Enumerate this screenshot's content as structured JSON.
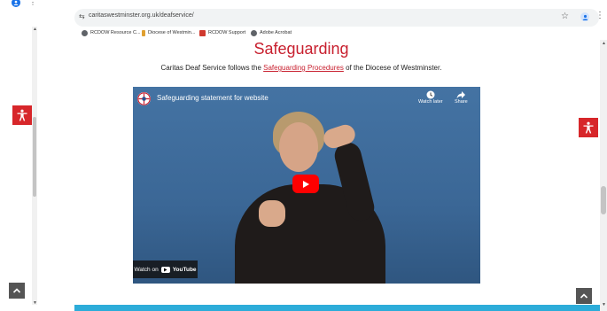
{
  "browser": {
    "url": "caritaswestminster.org.uk/deafservice/",
    "bookmarks": [
      {
        "label": "RCDOW Resource C...",
        "color": "#5f6368"
      },
      {
        "label": "Diocese of Westmin...",
        "color": "#e0a030"
      },
      {
        "label": "RCDOW Support",
        "color": "#d03a2f"
      },
      {
        "label": "Adobe Acrobat",
        "color": "#5f6368"
      }
    ]
  },
  "page": {
    "title": "Safeguarding",
    "intro_before": "Caritas Deaf Service follows the ",
    "intro_link": "Safeguarding Procedures",
    "intro_after": " of the Diocese of Westminster."
  },
  "video": {
    "title": "Safeguarding statement for website",
    "watch_later": "Watch later",
    "share": "Share",
    "watch_on": "Watch on",
    "youtube": "YouTube"
  },
  "colors": {
    "accent_red": "#c8202f",
    "accessibility_red": "#d7262a",
    "footer_blue": "#2cacd9"
  },
  "icons": [
    "tune-icon",
    "star-icon",
    "profile-icon",
    "more-icon",
    "accessibility-icon",
    "play-icon",
    "clock-icon",
    "share-icon",
    "chevron-up-icon"
  ]
}
